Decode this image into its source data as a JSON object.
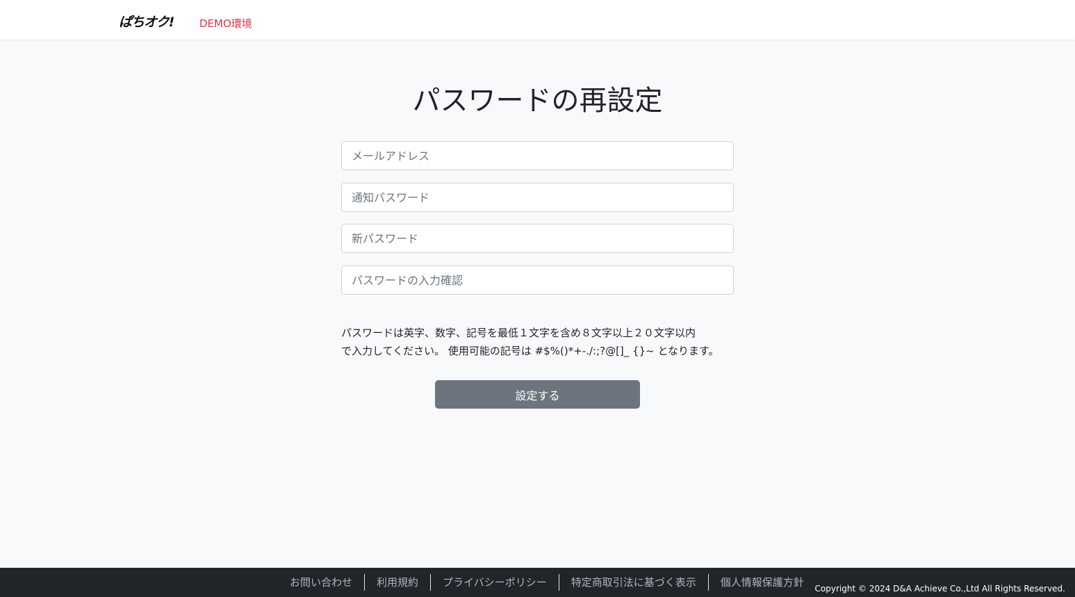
{
  "header": {
    "logo_text": "ぱちオク!",
    "env_label": "DEMO環境"
  },
  "main": {
    "title": "パスワードの再設定",
    "fields": {
      "email_placeholder": "メールアドレス",
      "notice_password_placeholder": "通知パスワード",
      "new_password_placeholder": "新パスワード",
      "confirm_password_placeholder": "パスワードの入力確認"
    },
    "notice_line1": "パスワードは英字、数字、記号を最低１文字を含め８文字以上２０文字以内",
    "notice_line2": "で入力してください。 使用可能の記号は #$%()*+-./:;?@[]_ {}~ となります。",
    "submit_label": "設定する"
  },
  "footer": {
    "links": [
      "お問い合わせ",
      "利用規約",
      "プライバシーポリシー",
      "特定商取引法に基づく表示",
      "個人情報保護方針"
    ],
    "copyright": "Copyright © 2024 D&A Achieve Co.,Ltd All Rights Reserved."
  },
  "colors": {
    "env_label": "#dc3545",
    "button_bg": "#6c757d",
    "footer_bg": "#212529",
    "page_bg": "#f8f9fa"
  }
}
